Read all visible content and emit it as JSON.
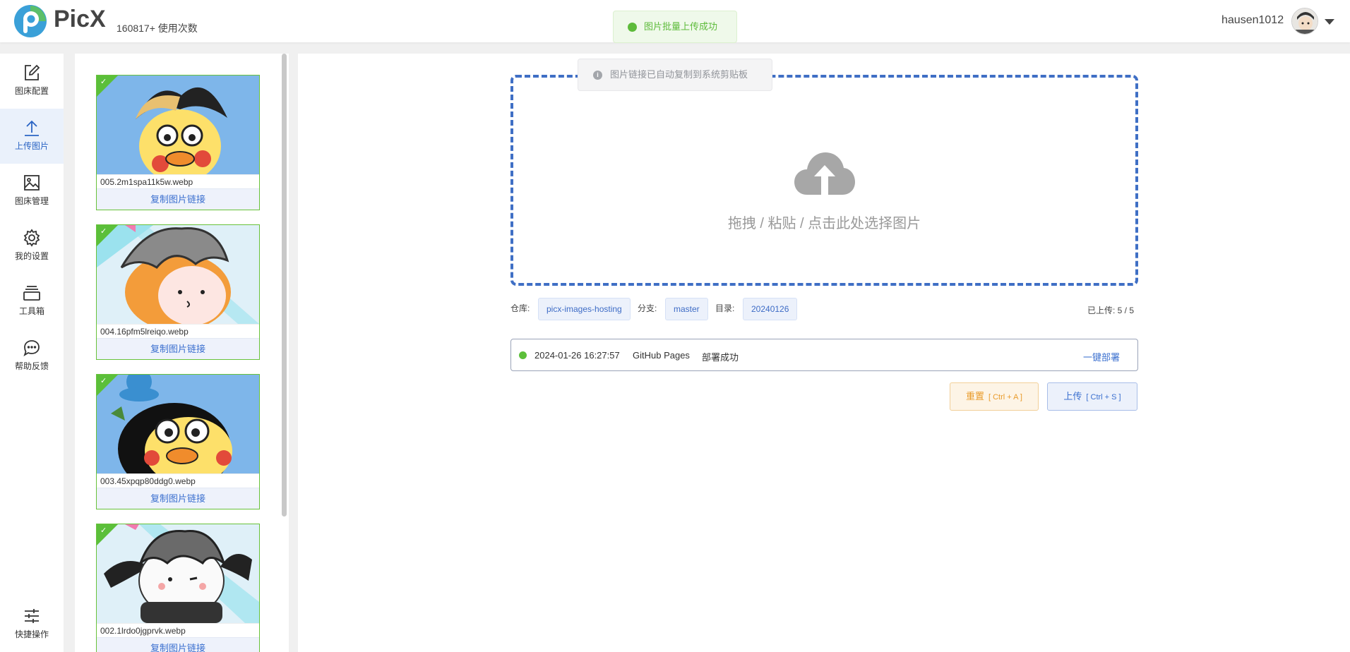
{
  "header": {
    "brand": "PicX",
    "usage": "160817+ 使用次数",
    "username": "hausen1012"
  },
  "nav": {
    "items": [
      {
        "label": "图床配置",
        "icon": "edit-icon"
      },
      {
        "label": "上传图片",
        "icon": "upload-icon",
        "active": true
      },
      {
        "label": "图床管理",
        "icon": "image-icon"
      },
      {
        "label": "我的设置",
        "icon": "gear-icon"
      },
      {
        "label": "工具箱",
        "icon": "toolbox-icon"
      },
      {
        "label": "帮助反馈",
        "icon": "chat-icon"
      }
    ],
    "bottom": {
      "label": "快捷操作",
      "icon": "sliders-icon"
    }
  },
  "images": [
    {
      "filename": "005.2m1spa11k5w.webp",
      "copy_label": "复制图片链接"
    },
    {
      "filename": "004.16pfm5lreiqo.webp",
      "copy_label": "复制图片链接"
    },
    {
      "filename": "003.45xpqp80ddg0.webp",
      "copy_label": "复制图片链接"
    },
    {
      "filename": "002.1lrdo0jgprvk.webp",
      "copy_label": "复制图片链接"
    }
  ],
  "dropzone": {
    "text": "拖拽 / 粘贴 / 点击此处选择图片"
  },
  "meta": {
    "repo_label": "仓库:",
    "repo": "picx-images-hosting",
    "branch_label": "分支:",
    "branch": "master",
    "dir_label": "目录:",
    "dir": "20240126",
    "uploaded": "已上传: 5 / 5"
  },
  "deploy": {
    "time": "2024-01-26 16:27:57",
    "target": "GitHub Pages",
    "status": "部署成功",
    "action": "一键部署"
  },
  "buttons": {
    "reset": "重置",
    "reset_kbd": "[ Ctrl + A ]",
    "upload": "上传",
    "upload_kbd": "[ Ctrl + S ]"
  },
  "toasts": {
    "success": "图片批量上传成功",
    "info": "图片链接已自动复制到系统剪贴板"
  },
  "colors": {
    "accent": "#3a6fcf",
    "success": "#5dbb3a",
    "warning": "#e99b2b"
  }
}
